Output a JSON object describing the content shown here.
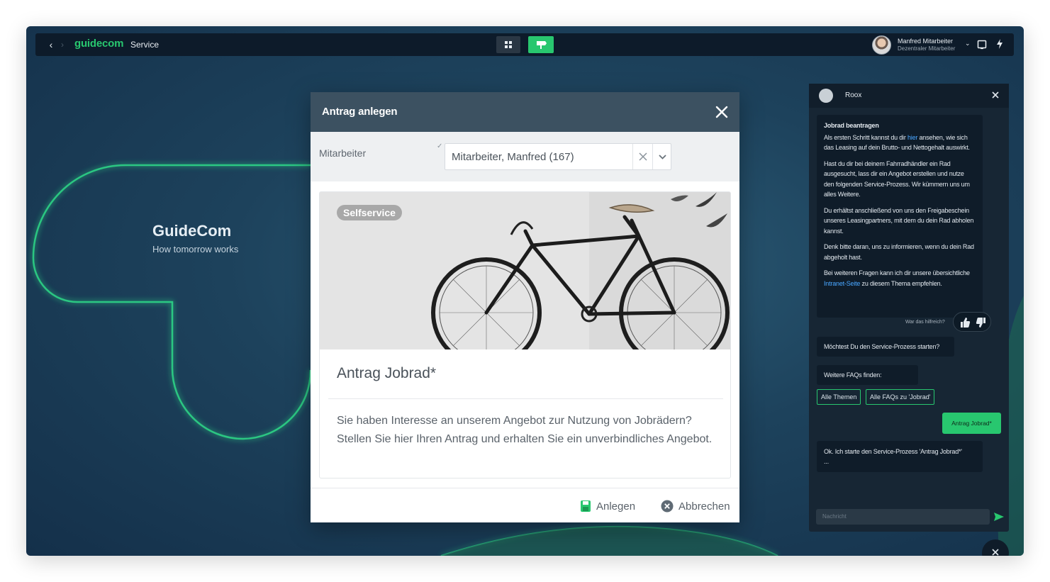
{
  "topbar": {
    "logo": "guidecom",
    "service_label": "Service",
    "user_name": "Manfred Mitarbeiter",
    "user_role": "Dezentraler Mitarbeiter"
  },
  "brand": {
    "title": "GuideCom",
    "subtitle": "How tomorrow works"
  },
  "modal": {
    "title": "Antrag anlegen",
    "field_label": "Mitarbeiter",
    "field_value": "Mitarbeiter, Manfred (167)",
    "card": {
      "badge": "Selfservice",
      "title": "Antrag Jobrad*",
      "description": "Sie haben Interesse an unserem Angebot zur Nutzung von Jobrädern? Stellen Sie hier Ihren Antrag und erhalten Sie ein unverbindliches Angebot."
    },
    "actions": {
      "create": "Anlegen",
      "cancel": "Abbrechen"
    }
  },
  "chat": {
    "bot_name": "Roox",
    "answer": {
      "heading": "Jobrad beantragen",
      "p1_before": "Als ersten Schritt kannst du dir ",
      "p1_link": "hier",
      "p1_after": " ansehen, wie sich das Leasing auf dein Brutto- und Nettogehalt auswirkt.",
      "p2": "Hast du dir bei deinem Fahrradhändler ein Rad ausgesucht, lass dir ein Angebot erstellen und nutze den folgenden Service-Prozess. Wir kümmern uns um alles Weitere.",
      "p3": "Du erhältst anschließend von uns den Freigabeschein unseres Leasingpartners, mit dem du dein Rad abholen kannst.",
      "p4": "Denk bitte daran, uns zu informieren, wenn du dein Rad abgeholt hast.",
      "p5_before": "Bei weiteren Fragen kann ich dir unsere übersichtliche ",
      "p5_link": "Intranet-Seite",
      "p5_after": " zu diesem Thema empfehlen."
    },
    "helpful_label": "War das hilfreich?",
    "question": "Möchtest Du den Service-Prozess starten?",
    "faq_label": "Weitere FAQs finden:",
    "chips": [
      "Alle Themen",
      "Alle FAQs zu 'Jobrad'"
    ],
    "user_message": "Antrag Jobrad*",
    "bot_reply": "Ok. Ich starte den Service-Prozess 'Antrag Jobrad*'",
    "bot_reply_dots": "...",
    "input_placeholder": "Nachricht"
  },
  "colors": {
    "accent": "#28c76f",
    "header": "#3c5161",
    "topbar": "#0d1b2a"
  }
}
